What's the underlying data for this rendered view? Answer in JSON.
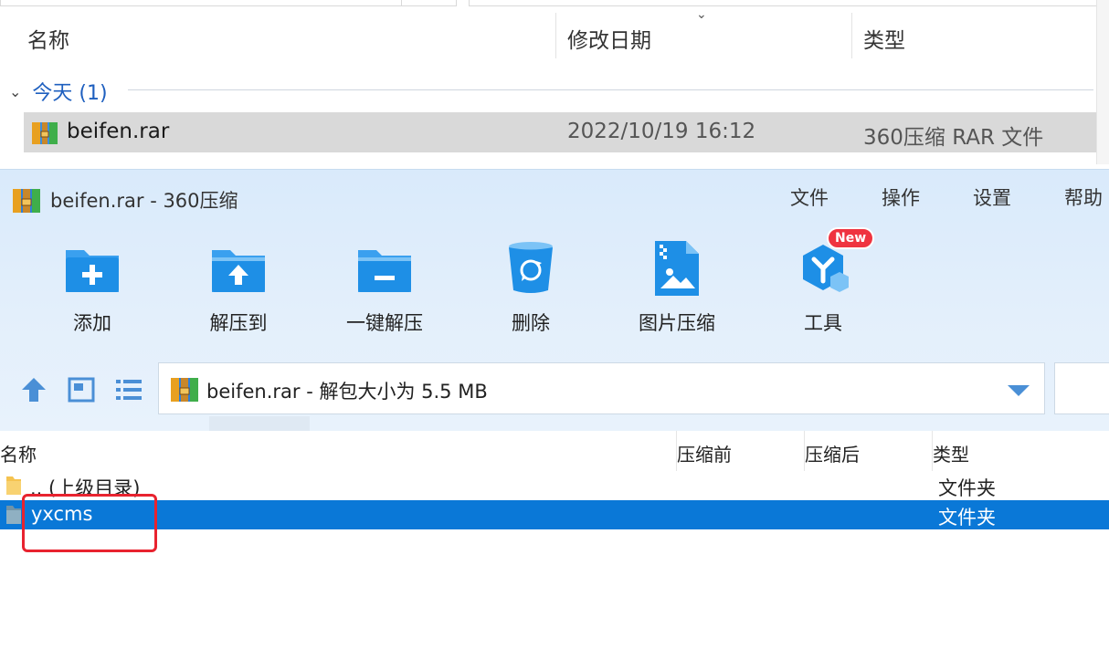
{
  "explorer": {
    "columns": {
      "name": "名称",
      "modified": "修改日期",
      "type": "类型"
    },
    "group_label": "今天 (1)",
    "file": {
      "name": "beifen.rar",
      "date": "2022/10/19 16:12",
      "type": "360压缩 RAR 文件"
    }
  },
  "zip_window": {
    "title": "beifen.rar - 360压缩",
    "menu": [
      "文件",
      "操作",
      "设置",
      "帮助"
    ],
    "toolbar": [
      {
        "label": "添加",
        "icon": "folder-add-icon"
      },
      {
        "label": "解压到",
        "icon": "folder-extract-icon"
      },
      {
        "label": "一键解压",
        "icon": "folder-oneclick-extract-icon"
      },
      {
        "label": "删除",
        "icon": "recycle-bin-icon"
      },
      {
        "label": "图片压缩",
        "icon": "image-compress-icon"
      },
      {
        "label": "工具",
        "icon": "tools-cube-icon"
      }
    ],
    "tools_badge": "New",
    "address": "beifen.rar - 解包大小为 5.5 MB",
    "list_columns": {
      "name": "名称",
      "before": "压缩前",
      "after": "压缩后",
      "type": "类型"
    },
    "rows": [
      {
        "name": ".. (上级目录)",
        "type": "文件夹"
      },
      {
        "name": "yxcms",
        "type": "文件夹"
      }
    ],
    "colors": {
      "accent": "#0a78d7",
      "highlight_border": "#e8232f",
      "icon_blue": "#1e8fe6",
      "badge_red": "#ef3340"
    }
  }
}
